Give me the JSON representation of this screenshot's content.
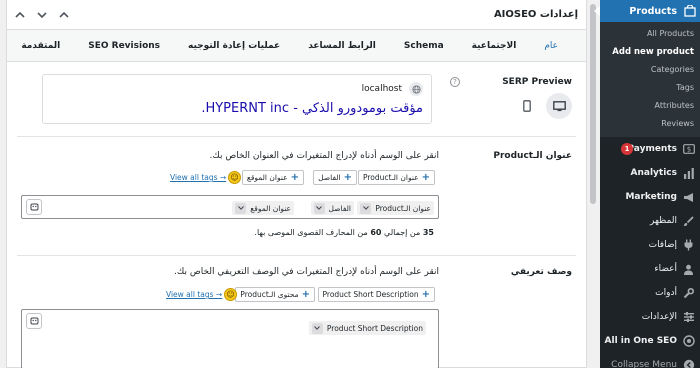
{
  "sidebar": {
    "current": {
      "label": "Products",
      "icon": "woo-products-icon"
    },
    "submenu": [
      {
        "label": "All Products"
      },
      {
        "label": "Add new product"
      },
      {
        "label": "Categories"
      },
      {
        "label": "Tags"
      },
      {
        "label": "Attributes"
      },
      {
        "label": "Reviews"
      }
    ],
    "items": [
      {
        "label": "Payments",
        "icon": "payments-icon",
        "badge": "1"
      },
      {
        "label": "Analytics",
        "icon": "analytics-icon"
      },
      {
        "label": "Marketing",
        "icon": "megaphone-icon"
      },
      {
        "label": "المظهر",
        "icon": "paintbrush-icon"
      },
      {
        "label": "إضافات",
        "icon": "plugin-icon"
      },
      {
        "label": "أعضاء",
        "icon": "users-icon"
      },
      {
        "label": "أدوات",
        "icon": "wrench-icon"
      },
      {
        "label": "الإعدادات",
        "icon": "settings-icon"
      },
      {
        "label": "All in One SEO",
        "icon": "aioseo-icon"
      },
      {
        "label": "Collapse Menu",
        "icon": "collapse-icon"
      }
    ]
  },
  "panel": {
    "title": "إعدادات AIOSEO",
    "tabs": [
      {
        "label": "عام"
      },
      {
        "label": "الاجتماعية"
      },
      {
        "label": "Schema"
      },
      {
        "label": "الرابط المساعد"
      },
      {
        "label": "عمليات إعادة التوجيه"
      },
      {
        "label": "SEO Revisions"
      },
      {
        "label": "المتقدمة"
      }
    ]
  },
  "serp": {
    "label": "SERP Preview",
    "domain": "localhost",
    "title": "مؤقت بومودورو الذكي - HYPERNT inc."
  },
  "title_section": {
    "label": "عنوان الـProduct",
    "instruction": "انقر على الوسم أدناه لإدراج المتغيرات في العنوان الخاص بك.",
    "tags": [
      "عنوان الـProduct",
      "الفاصل",
      "عنوان الموقع"
    ],
    "view_all": "View all tags →",
    "editor_tokens": [
      "عنوان الـProduct",
      "الفاصل",
      "عنوان الموقع"
    ],
    "counter_prefix": "35",
    "counter_mid": "من إجمالي",
    "counter_total": "60",
    "counter_suffix": "من المحارف القصوى الموصى بها."
  },
  "desc_section": {
    "label": "وصف تعريفي",
    "instruction": "انقر على الوسم أدناه لإدراج المتغيرات في الوصف التعريفي الخاص بك.",
    "tags": [
      "Product Short Description",
      "محتوى الـProduct"
    ],
    "view_all": "View all tags →",
    "editor_tokens": [
      "Product Short Description"
    ]
  }
}
